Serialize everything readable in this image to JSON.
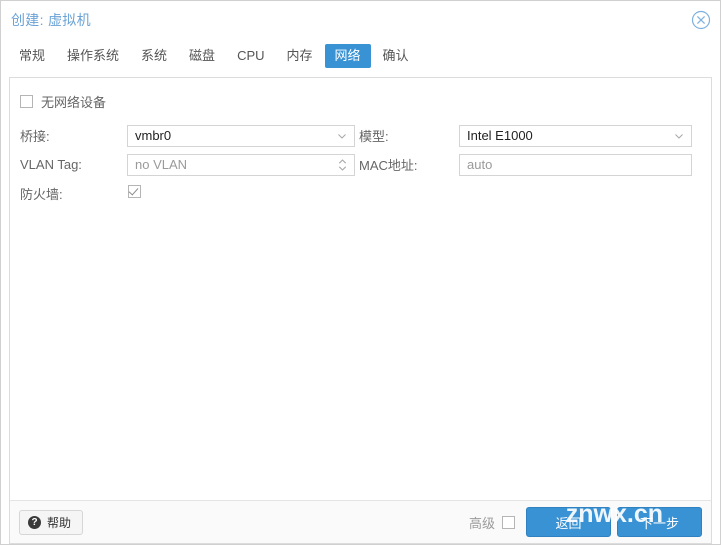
{
  "dialog": {
    "title": "创建: 虚拟机",
    "close_icon": "circle-x-icon"
  },
  "tabs": [
    {
      "label": "常规",
      "active": false
    },
    {
      "label": "操作系统",
      "active": false
    },
    {
      "label": "系统",
      "active": false
    },
    {
      "label": "磁盘",
      "active": false
    },
    {
      "label": "CPU",
      "active": false
    },
    {
      "label": "内存",
      "active": false
    },
    {
      "label": "网络",
      "active": true
    },
    {
      "label": "确认",
      "active": false
    }
  ],
  "form": {
    "no_network_device": {
      "label": "无网络设备",
      "checked": false
    },
    "bridge": {
      "label": "桥接:",
      "value": "vmbr0",
      "icon": "chevron-down-icon"
    },
    "vlan_tag": {
      "label": "VLAN Tag:",
      "value": "no VLAN",
      "is_placeholder": true,
      "icon": "spinner-updown-icon"
    },
    "firewall": {
      "label": "防火墙:",
      "checked": true
    },
    "model": {
      "label": "模型:",
      "value": "Intel E1000",
      "icon": "chevron-down-icon"
    },
    "mac_address": {
      "label": "MAC地址:",
      "value": "auto",
      "is_placeholder": true
    }
  },
  "footer": {
    "help_label": "帮助",
    "help_icon": "question-circle-icon",
    "advanced_label": "高级",
    "advanced_checked": false,
    "back_label": "返回",
    "next_label": "下一步"
  },
  "watermark": {
    "text": "znwx.cn"
  },
  "colors": {
    "accent": "#3892d4",
    "title": "#6ba3d6",
    "border": "#dcdcdc",
    "label": "#666666"
  }
}
